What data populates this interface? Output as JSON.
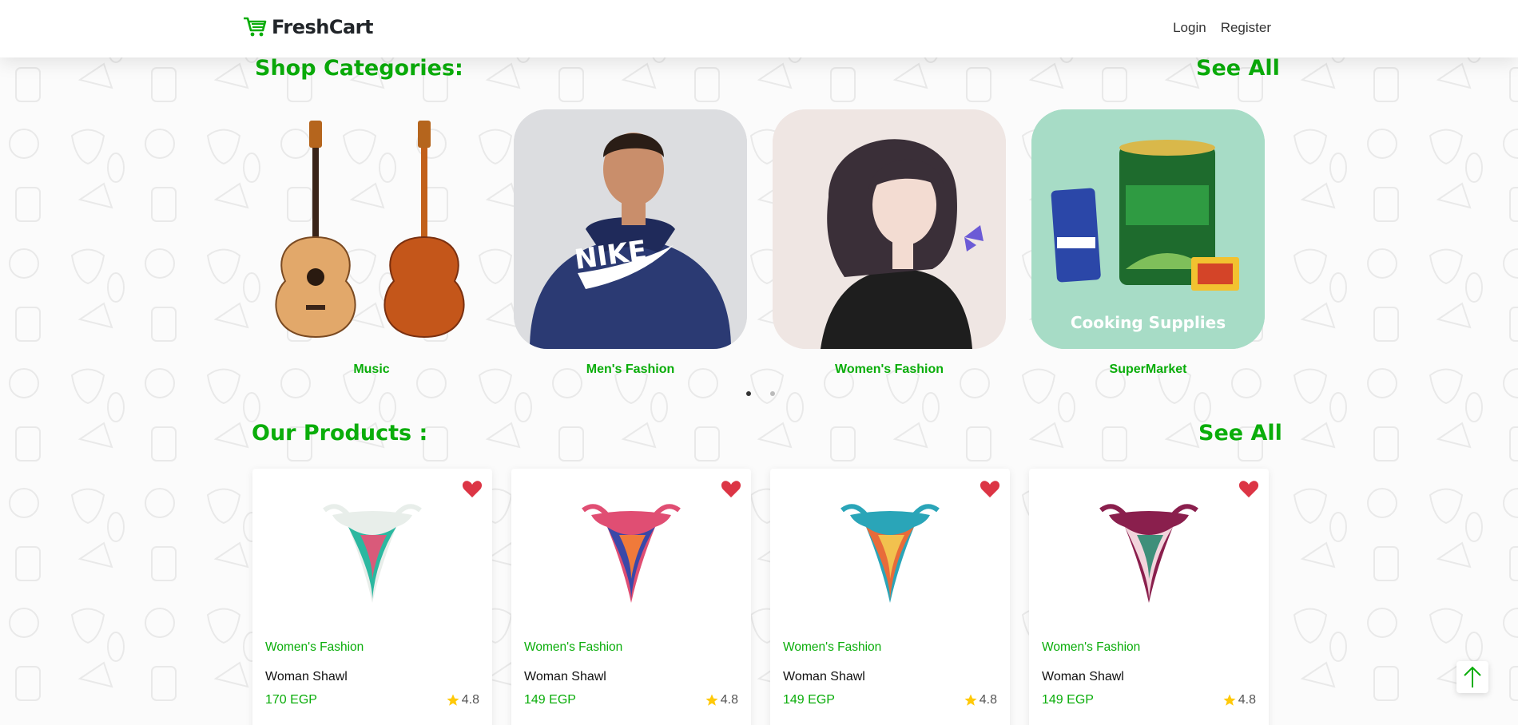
{
  "navbar": {
    "brand": "FreshCart",
    "links": [
      "Login",
      "Register"
    ]
  },
  "categories_section": {
    "title": "Shop Categories:",
    "see_all": "See All",
    "items": [
      {
        "label": "Music",
        "image_caption": ""
      },
      {
        "label": "Men's Fashion",
        "image_caption": ""
      },
      {
        "label": "Women's Fashion",
        "image_caption": ""
      },
      {
        "label": "SuperMarket",
        "image_caption": "Cooking Supplies"
      }
    ]
  },
  "products_section": {
    "title": "Our Products :",
    "see_all": "See All",
    "items": [
      {
        "category": "Women's Fashion",
        "name": "Woman Shawl",
        "price": "170 EGP",
        "rating": "4.8",
        "colors": [
          "#e8eeea",
          "#2bb8a0",
          "#d95a7a"
        ]
      },
      {
        "category": "Women's Fashion",
        "name": "Woman Shawl",
        "price": "149 EGP",
        "rating": "4.8",
        "colors": [
          "#e04e73",
          "#3a48a8",
          "#f07a3a"
        ]
      },
      {
        "category": "Women's Fashion",
        "name": "Woman Shawl",
        "price": "149 EGP",
        "rating": "4.8",
        "colors": [
          "#2aa5b8",
          "#e86b3a",
          "#f2c14e"
        ]
      },
      {
        "category": "Women's Fashion",
        "name": "Woman Shawl",
        "price": "149 EGP",
        "rating": "4.8",
        "colors": [
          "#8a1f4d",
          "#f2d4dc",
          "#3e8f7a"
        ]
      }
    ]
  },
  "colors": {
    "accent": "#0aad0a",
    "heart": "#dc3545",
    "star": "#ffc908"
  },
  "icons": {
    "brand": "cart-icon",
    "favorite": "heart-icon",
    "rating": "star-icon",
    "scroll_top": "arrow-up-icon"
  }
}
